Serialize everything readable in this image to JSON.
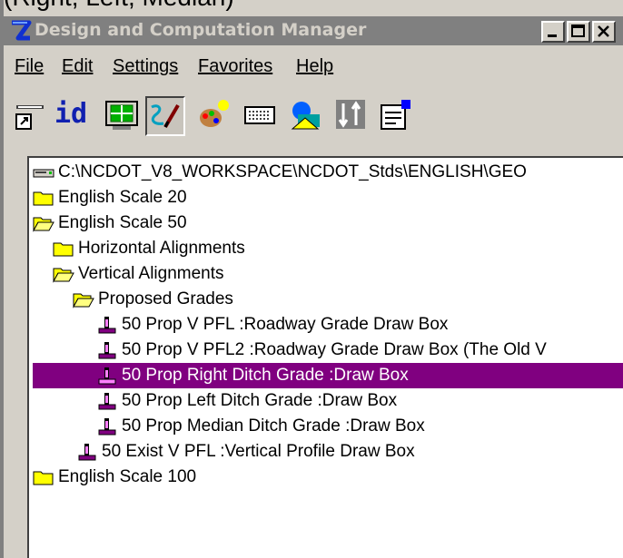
{
  "caption_clip": "(Right, Left, Median)",
  "window": {
    "title": "Design and Computation Manager",
    "controls": {
      "minimize": "_",
      "maximize": "□",
      "close": "×"
    }
  },
  "menu": [
    {
      "label": "File"
    },
    {
      "label": "Edit"
    },
    {
      "label": "Settings"
    },
    {
      "label": "Favorites"
    },
    {
      "label": "Help"
    }
  ],
  "toolbar": {
    "id_label": "id",
    "tools": [
      "key-in-icon",
      "id-icon",
      "table-icon",
      "draw-icon",
      "palette-icon",
      "keyboard-icon",
      "shapes-icon",
      "sort-icon",
      "properties-icon"
    ]
  },
  "tree": {
    "root": "C:\\NCDOT_V8_WORKSPACE\\NCDOT_Stds\\ENGLISH\\GEO",
    "items": [
      {
        "label": "English Scale  20"
      },
      {
        "label": "English Scale  50"
      },
      {
        "label": "Horizontal Alignments"
      },
      {
        "label": "Vertical Alignments"
      },
      {
        "label": "Proposed Grades"
      },
      {
        "label": "50 Prop V PFL :Roadway Grade Draw Box"
      },
      {
        "label": "50 Prop V PFL2 :Roadway Grade Draw Box (The Old V"
      },
      {
        "label": "50 Prop Right Ditch Grade :Draw Box"
      },
      {
        "label": "50 Prop Left Ditch Grade :Draw Box"
      },
      {
        "label": "50 Prop Median Ditch Grade :Draw Box"
      },
      {
        "label": "50 Exist V PFL :Vertical Profile Draw Box"
      },
      {
        "label": "English Scale  100"
      }
    ]
  },
  "colors": {
    "selection": "#800080",
    "titlebar": "#808080",
    "face": "#d4d0c8",
    "folder": "#ffff00"
  }
}
